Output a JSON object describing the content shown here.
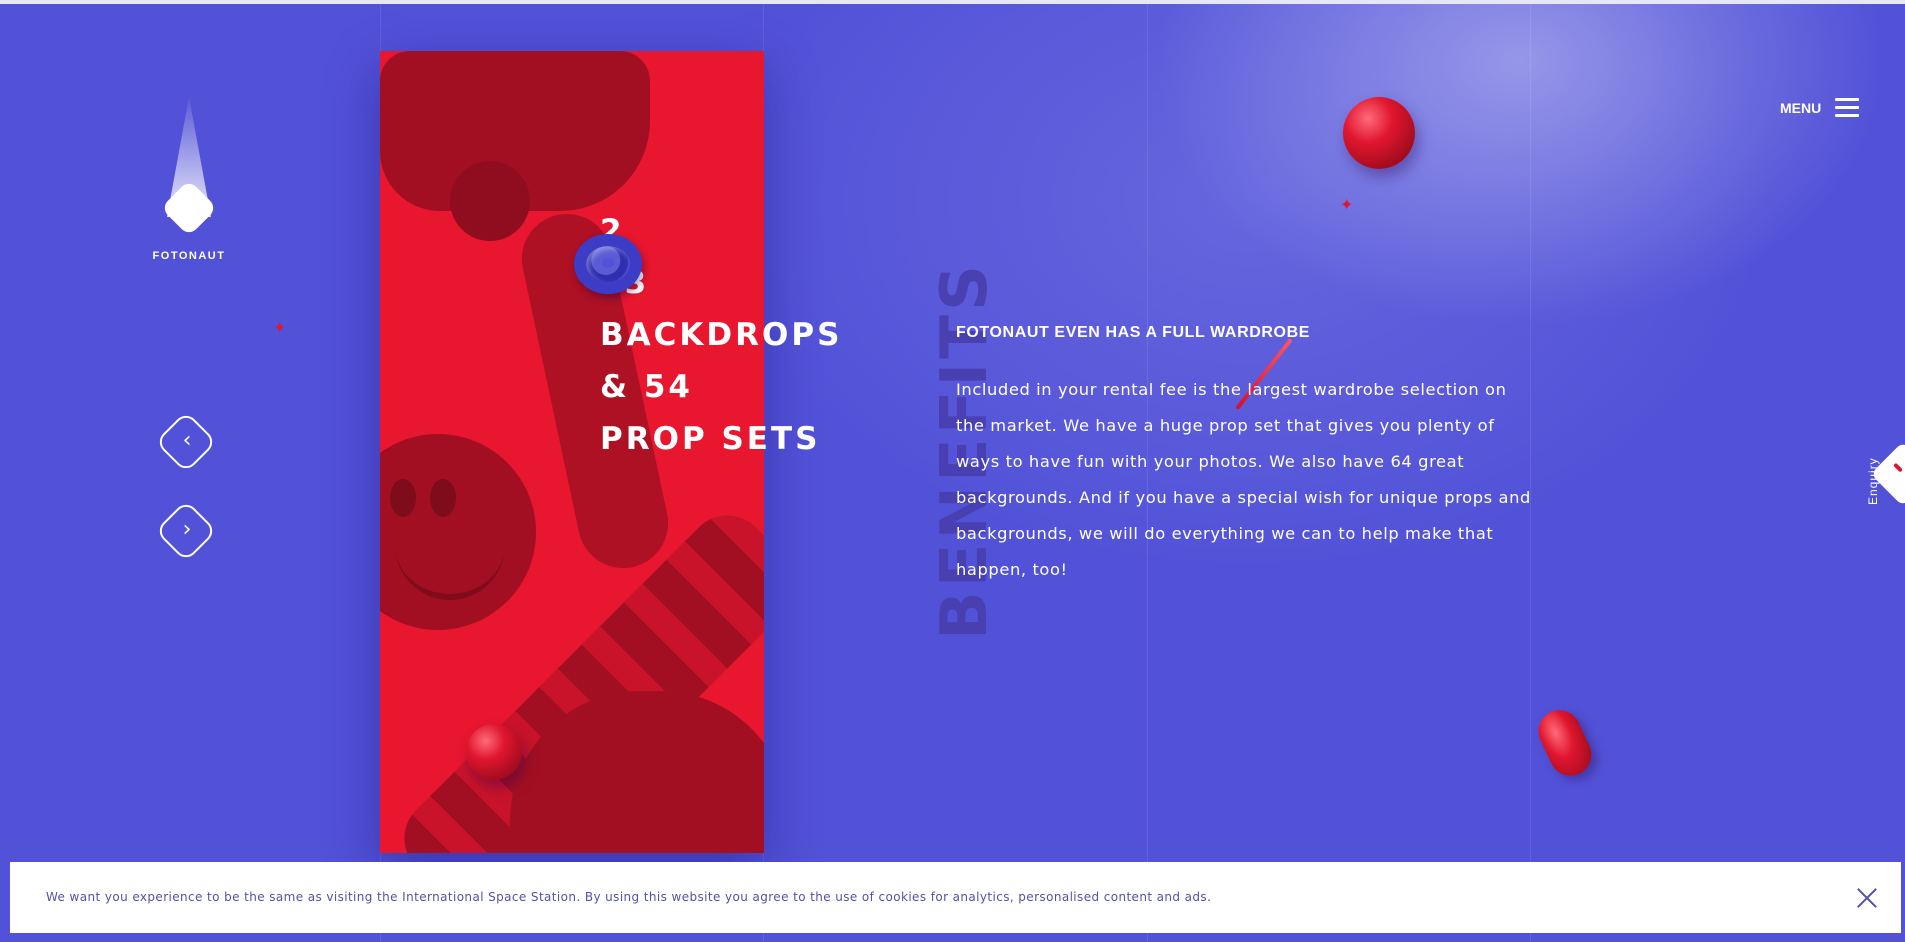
{
  "brand": {
    "name": "FOTONAUT"
  },
  "nav": {
    "prev_icon": "chevron-left-icon",
    "next_icon": "chevron-right-icon"
  },
  "slide": {
    "index": "2",
    "title_lines": [
      "63",
      "BACKDROPS",
      "& 54",
      "PROP SETS"
    ]
  },
  "benefits": {
    "label": "BENEFITS",
    "heading": "FOTONAUT EVEN HAS A FULL WARDROBE",
    "body": "Included in your rental fee is the largest wardrobe selection on the market. We have a huge prop set that gives you plenty of ways to have fun with your photos. We also have 64 great backgrounds. And if you have a special wish for unique props and backgrounds, we will do everything we can to help make that happen, too!"
  },
  "menu": {
    "label": "MENU",
    "icon": "hamburger-icon"
  },
  "enquiry": {
    "label": "Enquiry"
  },
  "cookie": {
    "text": "We want you experience to be the same as visiting the International Space Station. By using this website you agree to the use of cookies for analytics, personalised content and ads.",
    "close_icon": "close-icon"
  },
  "colors": {
    "background": "#5252d8",
    "accent_red": "#e8162f",
    "card_dark": "#a30f22",
    "cookie_text": "#5252a8"
  }
}
